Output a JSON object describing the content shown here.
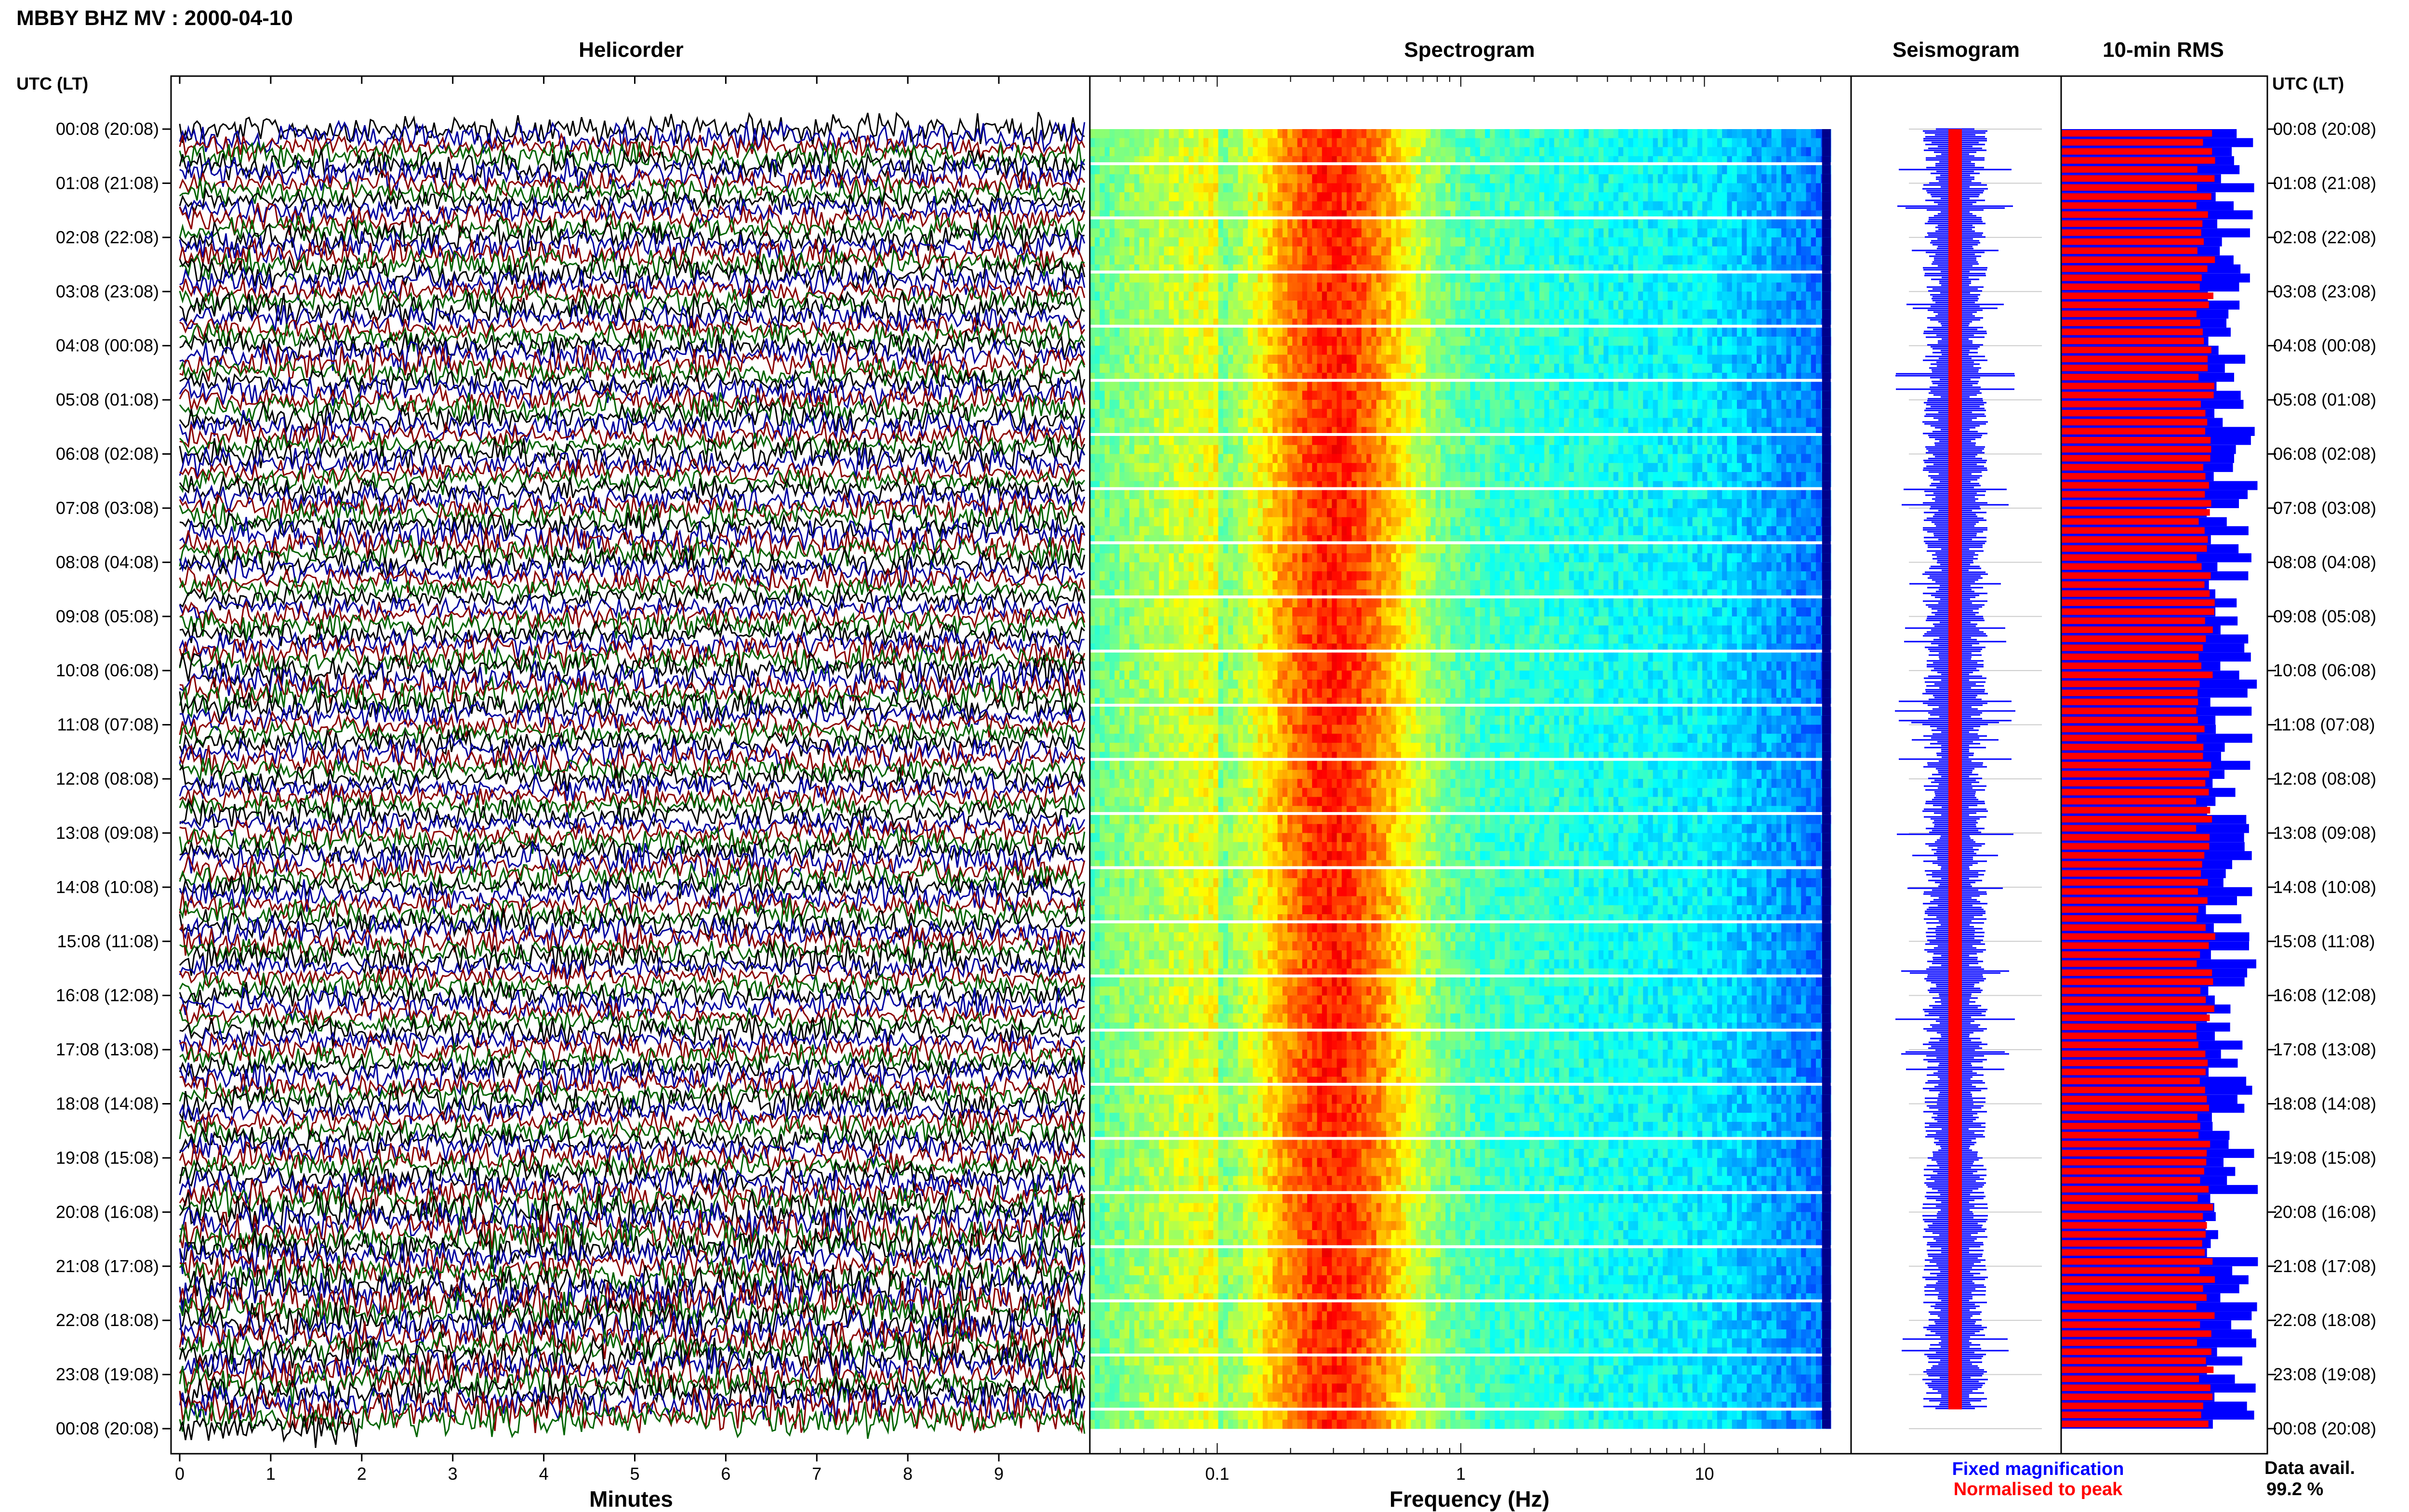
{
  "page": {
    "title": "MBBY BHZ MV : 2000-04-10"
  },
  "chart_data": [
    {
      "type": "helicorder",
      "title": "Helicorder",
      "xlabel": "Minutes",
      "ylabel": "UTC (LT)",
      "x_ticks": [
        0,
        1,
        2,
        3,
        4,
        5,
        6,
        7,
        8,
        9
      ],
      "xlim": [
        0,
        10
      ],
      "row_minutes": 10,
      "rows_per_hour": 6,
      "rows": 145,
      "trace_colors": [
        "#000000",
        "#0000a0",
        "#8b0000",
        "#006400"
      ],
      "time_labels": [
        "00:08 (20:08)",
        "01:08 (21:08)",
        "02:08 (22:08)",
        "03:08 (23:08)",
        "04:08 (00:08)",
        "05:08 (01:08)",
        "06:08 (02:08)",
        "07:08 (03:08)",
        "08:08 (04:08)",
        "09:08 (05:08)",
        "10:08 (06:08)",
        "11:08 (07:08)",
        "12:08 (08:08)",
        "13:08 (09:08)",
        "14:08 (10:08)",
        "15:08 (11:08)",
        "16:08 (12:08)",
        "17:08 (13:08)",
        "18:08 (14:08)",
        "19:08 (15:08)",
        "20:08 (16:08)",
        "21:08 (17:08)",
        "22:08 (18:08)",
        "23:08 (19:08)",
        "00:08 (20:08)"
      ]
    },
    {
      "type": "heatmap",
      "title": "Spectrogram",
      "xlabel": "Frequency (Hz)",
      "x_scale": "log",
      "x_ticks": [
        0.1,
        1,
        10
      ],
      "xlim": [
        0.03,
        40
      ],
      "data_max_freq": 33,
      "colormap": "jet"
    },
    {
      "type": "seismogram",
      "title": "Seismogram",
      "series": [
        {
          "name": "Fixed magnification",
          "color": "#0000ff"
        },
        {
          "name": "Normalised to peak",
          "color": "#ff0000"
        }
      ]
    },
    {
      "type": "bar",
      "title": "10-min RMS",
      "orientation": "horizontal",
      "series": [
        {
          "name": "Fixed magnification",
          "color": "#0000ff"
        },
        {
          "name": "Normalised to peak",
          "color": "#ff0000"
        }
      ]
    }
  ],
  "legend": {
    "fixed": "Fixed magnification",
    "normalised": "Normalised to peak",
    "fixed_color": "#0000ff",
    "normalised_color": "#ff0000"
  },
  "data_avail": {
    "label": "Data avail.",
    "value": "99.2 %"
  }
}
